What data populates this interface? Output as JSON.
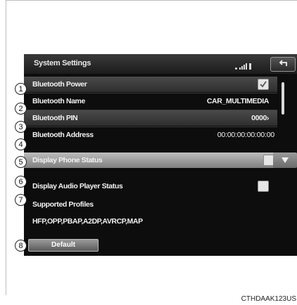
{
  "header": {
    "title": "System Settings"
  },
  "rows": [
    {
      "label": "Bluetooth Power",
      "checked": true
    },
    {
      "label": "Bluetooth Name",
      "value": "CAR_MULTIMEDIA"
    },
    {
      "label": "Bluetooth PIN",
      "value": "0000"
    },
    {
      "label": "Bluetooth Address",
      "value": "00:00:00:00:00:00"
    },
    {
      "label": "Display Phone Status",
      "checked": false
    },
    {
      "label": "Display Audio Player Status",
      "checked": false
    },
    {
      "label": "Supported Profiles"
    }
  ],
  "profiles_value": "HFP,OPP,PBAP,A2DP,AVRCP,MAP",
  "default_button": "Default",
  "callouts": [
    "1",
    "2",
    "3",
    "4",
    "5",
    "6",
    "7",
    "8"
  ],
  "caption": "CTHDAAK123US",
  "icons": {
    "back": "back-arrow-icon",
    "check": "checkmark-icon",
    "scroll_down": "chevron-down-icon",
    "signal": "signal-icon",
    "battery": "battery-icon"
  },
  "colors": {
    "screen_bg": "#0d0d0d",
    "selected_row": "#9e9e9e",
    "text": "#f2f2f2"
  }
}
